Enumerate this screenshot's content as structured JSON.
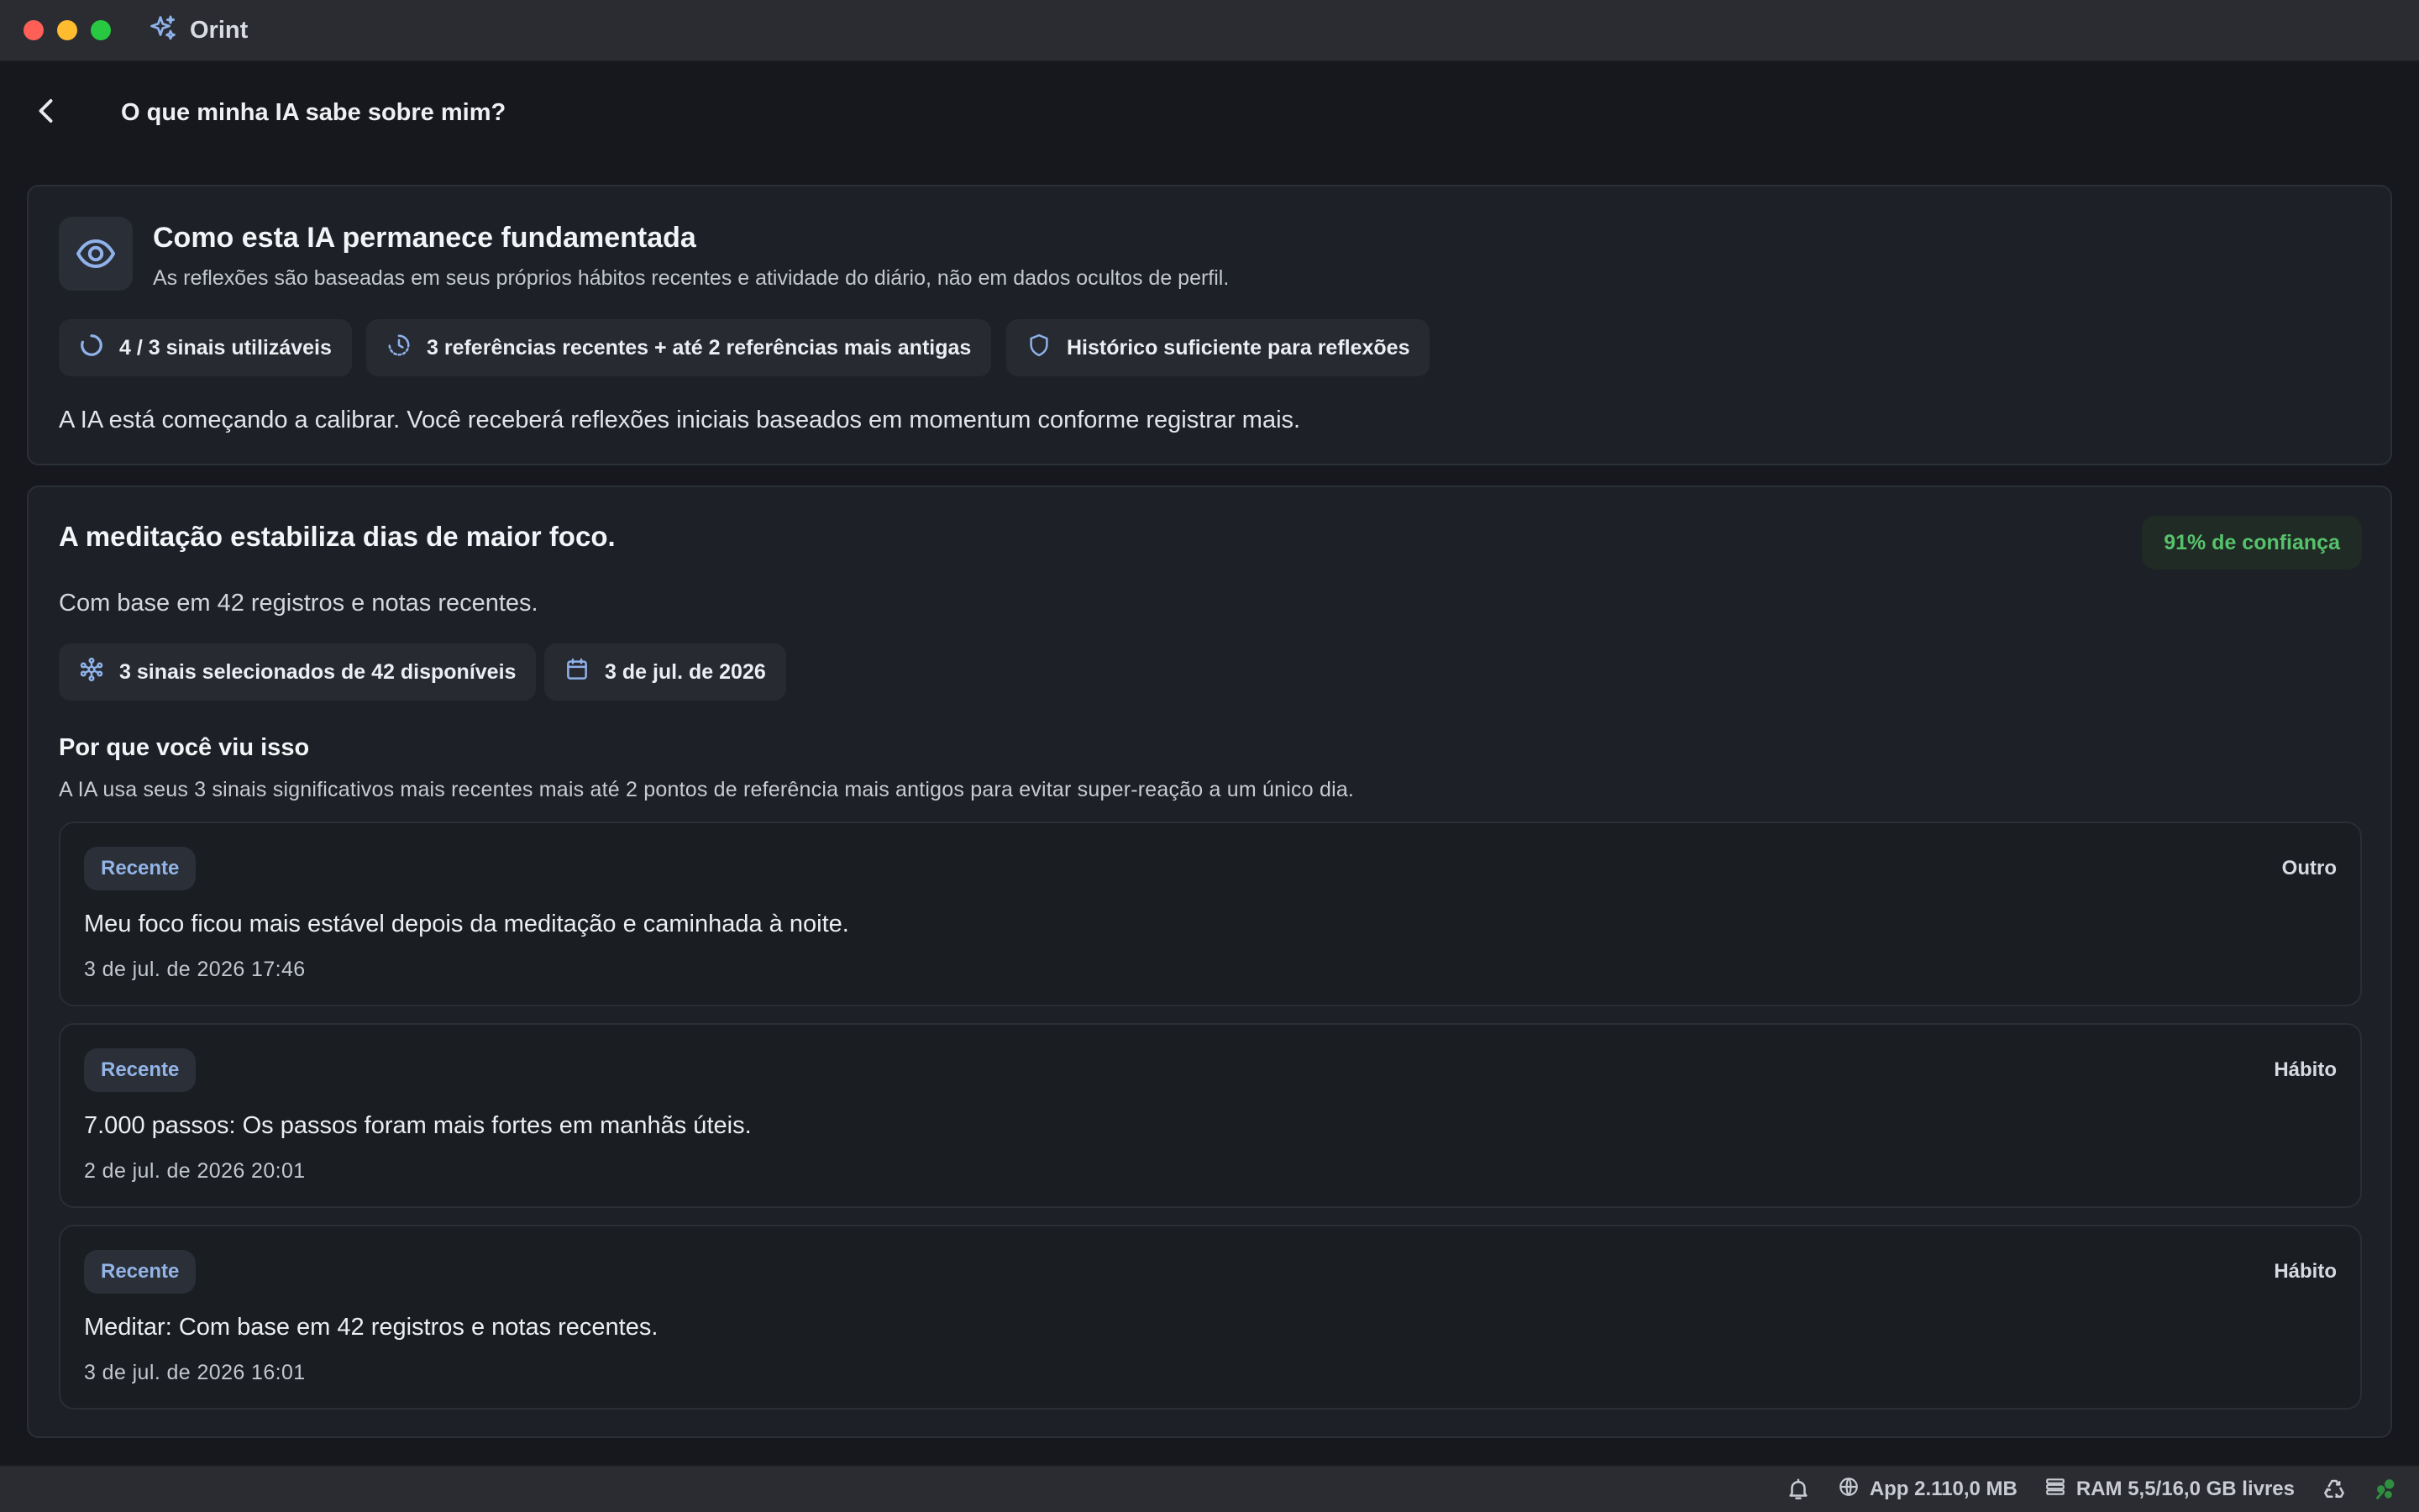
{
  "app": {
    "name": "Orint"
  },
  "header": {
    "title": "O que minha IA sabe sobre mim?"
  },
  "grounding": {
    "title": "Como esta IA permanece fundamentada",
    "subtitle": "As reflexões são baseadas em seus próprios hábitos recentes e atividade do diário, não em dados ocultos de perfil.",
    "chips": {
      "signals": "4 / 3 sinais utilizáveis",
      "references": "3 referências recentes + até 2 referências mais antigas",
      "history": "Histórico suficiente para reflexões"
    },
    "calibration": "A IA está começando a calibrar. Você receberá reflexões iniciais baseados em momentum conforme registrar mais."
  },
  "insight": {
    "title": "A meditação estabiliza dias de maior foco.",
    "confidence": "91% de confiança",
    "basis": "Com base em 42 registros e notas recentes.",
    "chips": {
      "selected": "3 sinais selecionados de 42 disponíveis",
      "date": "3 de jul. de 2026"
    },
    "why_title": "Por que você viu isso",
    "why_text": "A IA usa seus 3 sinais significativos mais recentes mais até 2 pontos de referência mais antigos para evitar super-reação a um único dia.",
    "entries": [
      {
        "badge": "Recente",
        "kind": "Outro",
        "text": "Meu foco ficou mais estável depois da meditação e caminhada à noite.",
        "date": "3 de jul. de 2026 17:46"
      },
      {
        "badge": "Recente",
        "kind": "Hábito",
        "text": "7.000 passos: Os passos foram mais fortes em manhãs úteis.",
        "date": "2 de jul. de 2026 20:01"
      },
      {
        "badge": "Recente",
        "kind": "Hábito",
        "text": "Meditar: Com base em 42 registros e notas recentes.",
        "date": "3 de jul. de 2026 16:01"
      }
    ]
  },
  "statusbar": {
    "app_memory": "App 2.110,0 MB",
    "ram": "RAM 5,5/16,0 GB livres"
  },
  "colors": {
    "accent": "#8fb2ea",
    "confidence_green": "#57c26c",
    "background": "#16181d",
    "card": "#1d2026"
  },
  "icons": [
    "sparkles-icon",
    "chevron-left-icon",
    "eye-icon",
    "spinner-icon",
    "clock-history-icon",
    "shield-icon",
    "network-icon",
    "calendar-icon",
    "bell-icon",
    "globe-icon",
    "memory-icon",
    "recycle-icon",
    "status-indicator-icon"
  ]
}
